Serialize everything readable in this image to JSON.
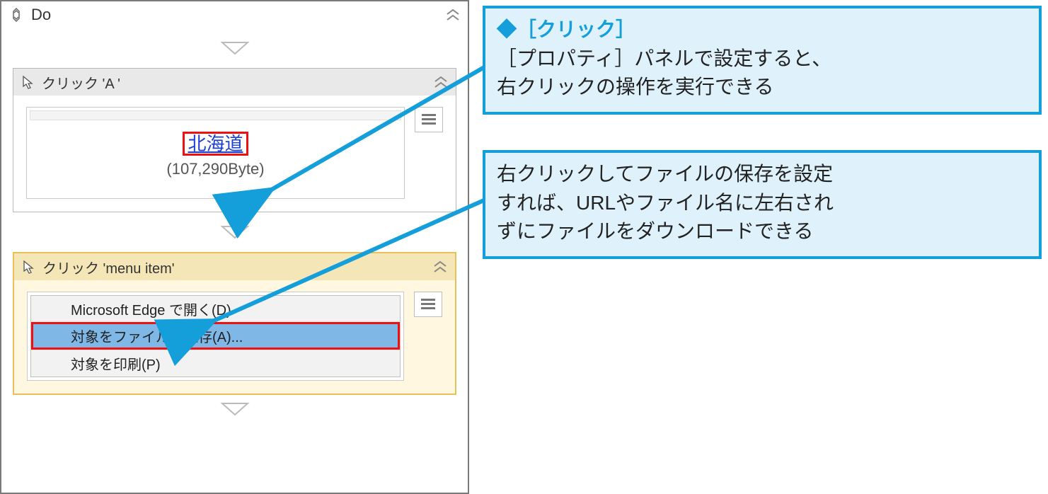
{
  "workflow": {
    "do_label": "Do",
    "activity1": {
      "title": "クリック 'A '",
      "link_label": "北海道",
      "size_label": "(107,290Byte)"
    },
    "activity2": {
      "title": "クリック 'menu item'",
      "menu": {
        "item1": "Microsoft Edge で開く(D)",
        "item2": "対象をファイルに保存(A)...",
        "item3": "対象を印刷(P)"
      }
    }
  },
  "callouts": {
    "c1": {
      "heading_marker": "◆",
      "heading_text": "［クリック］",
      "body_line1": "［プロパティ］パネルで設定すると、",
      "body_line2": "右クリックの操作を実行できる"
    },
    "c2": {
      "line1": "右クリックしてファイルの保存を設定",
      "line2": "すれば、URLやファイル名に左右され",
      "line3": "ずにファイルをダウンロードできる"
    }
  }
}
